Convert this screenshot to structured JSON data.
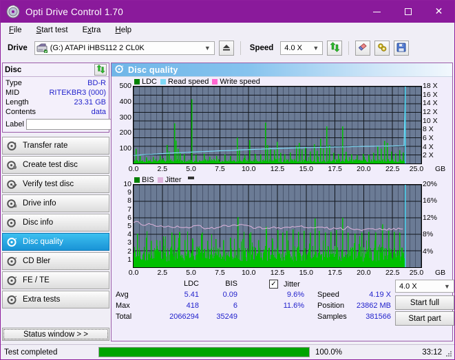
{
  "window": {
    "title": "Opti Drive Control 1.70",
    "icon": "disc-icon",
    "minimize": "minimize-icon",
    "maximize": "maximize-icon",
    "close": "close-icon"
  },
  "menu": [
    {
      "label": "File",
      "accel": "F"
    },
    {
      "label": "Start test",
      "accel": "S"
    },
    {
      "label": "Extra",
      "accel": "x"
    },
    {
      "label": "Help",
      "accel": "H"
    }
  ],
  "toolbar": {
    "drive_label": "Drive",
    "drive_value": "(G:)  ATAPI iHBS112  2 CL0K",
    "eject_icon": "eject-icon",
    "speed_label": "Speed",
    "speed_value": "4.0 X",
    "refresh_icon": "refresh-icon",
    "eraser_icon": "eraser-icon",
    "tools_icon": "tools-icon",
    "save_icon": "save-icon"
  },
  "disc": {
    "title": "Disc",
    "refresh_icon": "refresh-icon",
    "rows": [
      {
        "key": "Type",
        "value": "BD-R"
      },
      {
        "key": "MID",
        "value": "RITEKBR3 (000)"
      },
      {
        "key": "Length",
        "value": "23.31 GB"
      },
      {
        "key": "Contents",
        "value": "data"
      }
    ],
    "label_key": "Label",
    "label_value": "",
    "label_placeholder": "",
    "label_button_icon": "disc-icon"
  },
  "nav": {
    "items": [
      {
        "label": "Transfer rate",
        "icon": "disc-speed-icon",
        "active": false
      },
      {
        "label": "Create test disc",
        "icon": "disc-write-icon",
        "active": false
      },
      {
        "label": "Verify test disc",
        "icon": "disc-check-icon",
        "active": false
      },
      {
        "label": "Drive info",
        "icon": "drive-info-icon",
        "active": false
      },
      {
        "label": "Disc info",
        "icon": "disc-info-icon",
        "active": false
      },
      {
        "label": "Disc quality",
        "icon": "disc-quality-icon",
        "active": true
      },
      {
        "label": "CD Bler",
        "icon": "cd-bler-icon",
        "active": false
      },
      {
        "label": "FE / TE",
        "icon": "fe-te-icon",
        "active": false
      },
      {
        "label": "Extra tests",
        "icon": "extra-tests-icon",
        "active": false
      }
    ],
    "status_window": "Status window > >"
  },
  "main": {
    "title": "Disc quality",
    "icon": "disc-quality-icon"
  },
  "stats": {
    "col_ldc": "LDC",
    "col_bis": "BIS",
    "jitter_label": "Jitter",
    "jitter_checked": true,
    "row_avg": "Avg",
    "row_max": "Max",
    "row_total": "Total",
    "ldc_avg": "5.41",
    "ldc_max": "418",
    "ldc_total": "2066294",
    "bis_avg": "0.09",
    "bis_max": "6",
    "bis_total": "35249",
    "jitter_avg": "9.6%",
    "jitter_max": "11.6%",
    "speed_label": "Speed",
    "speed_value": "4.19 X",
    "position_label": "Position",
    "position_value": "23862 MB",
    "samples_label": "Samples",
    "samples_value": "381566",
    "speed_select": "4.0 X",
    "start_full": "Start full",
    "start_part": "Start part"
  },
  "statusbar": {
    "text": "Test completed",
    "percent_label": "100.0%",
    "percent_value": 100,
    "time": "33:12"
  },
  "colors": {
    "title_bar": "#8a1a9b",
    "plot_bg": "#6b7b95",
    "ldc_green": "#00c000",
    "read_speed": "#7fd8f5",
    "write_speed": "#ff66d0",
    "jitter_pink": "#e0b4dd",
    "accent_blue": "#2222cc",
    "progress_green": "#00a400"
  },
  "chart_data": [
    {
      "type": "area",
      "id": "ldc-chart",
      "title": "",
      "xlabel": "GB",
      "ylabel": "",
      "xlim": [
        0,
        25
      ],
      "ylim": [
        0,
        500
      ],
      "y2lim": [
        0,
        18
      ],
      "grid": true,
      "legend_position": "top-left",
      "legend": [
        "LDC",
        "Read speed",
        "Write speed"
      ],
      "xticks": [
        "0.0",
        "2.5",
        "5.0",
        "7.5",
        "10.0",
        "12.5",
        "15.0",
        "17.5",
        "20.0",
        "22.5",
        "25.0"
      ],
      "yticks": [
        100,
        200,
        300,
        400,
        500
      ],
      "y2ticks": [
        "2 X",
        "4 X",
        "6 X",
        "8 X",
        "10 X",
        "12 X",
        "14 X",
        "16 X",
        "18 X"
      ],
      "x_unit": "GB",
      "series": [
        {
          "name": "LDC",
          "color": "#00c000",
          "kind": "bars",
          "note": "dense noisy baseline ~15-40 with sparse tall spikes",
          "baseline": 22,
          "x_end": 23.6,
          "spikes": [
            {
              "x": 0.15,
              "y": 95
            },
            {
              "x": 0.55,
              "y": 48
            },
            {
              "x": 1.1,
              "y": 40
            },
            {
              "x": 1.7,
              "y": 42
            },
            {
              "x": 2.25,
              "y": 52
            },
            {
              "x": 2.9,
              "y": 120
            },
            {
              "x": 3.05,
              "y": 78
            },
            {
              "x": 3.5,
              "y": 262
            },
            {
              "x": 3.62,
              "y": 150
            },
            {
              "x": 3.8,
              "y": 95
            },
            {
              "x": 4.0,
              "y": 70
            },
            {
              "x": 4.35,
              "y": 60
            },
            {
              "x": 5.05,
              "y": 418
            },
            {
              "x": 5.4,
              "y": 55
            },
            {
              "x": 6.1,
              "y": 62
            },
            {
              "x": 6.6,
              "y": 45
            },
            {
              "x": 7.2,
              "y": 50
            },
            {
              "x": 7.9,
              "y": 58
            },
            {
              "x": 8.4,
              "y": 48
            },
            {
              "x": 8.95,
              "y": 168
            },
            {
              "x": 9.15,
              "y": 88
            },
            {
              "x": 9.6,
              "y": 55
            },
            {
              "x": 10.05,
              "y": 152
            },
            {
              "x": 10.5,
              "y": 62
            },
            {
              "x": 11.0,
              "y": 60
            },
            {
              "x": 11.45,
              "y": 265
            },
            {
              "x": 11.6,
              "y": 120
            },
            {
              "x": 11.85,
              "y": 95
            },
            {
              "x": 12.2,
              "y": 88
            },
            {
              "x": 12.45,
              "y": 140
            },
            {
              "x": 12.75,
              "y": 70
            },
            {
              "x": 13.1,
              "y": 60
            },
            {
              "x": 13.6,
              "y": 72
            },
            {
              "x": 14.1,
              "y": 115
            },
            {
              "x": 14.35,
              "y": 135
            },
            {
              "x": 14.6,
              "y": 92
            },
            {
              "x": 14.9,
              "y": 108
            },
            {
              "x": 15.3,
              "y": 78
            },
            {
              "x": 15.65,
              "y": 125
            },
            {
              "x": 15.9,
              "y": 82
            },
            {
              "x": 16.2,
              "y": 160
            },
            {
              "x": 16.45,
              "y": 95
            },
            {
              "x": 16.75,
              "y": 240
            },
            {
              "x": 17.0,
              "y": 120
            },
            {
              "x": 17.35,
              "y": 70
            },
            {
              "x": 17.75,
              "y": 62
            },
            {
              "x": 18.15,
              "y": 240
            },
            {
              "x": 18.45,
              "y": 75
            },
            {
              "x": 18.9,
              "y": 60
            },
            {
              "x": 19.4,
              "y": 55
            },
            {
              "x": 19.9,
              "y": 62
            },
            {
              "x": 20.4,
              "y": 58
            },
            {
              "x": 20.8,
              "y": 70
            },
            {
              "x": 21.2,
              "y": 112
            },
            {
              "x": 21.5,
              "y": 95
            },
            {
              "x": 21.8,
              "y": 148
            },
            {
              "x": 22.0,
              "y": 135
            },
            {
              "x": 22.35,
              "y": 78
            },
            {
              "x": 22.7,
              "y": 65
            },
            {
              "x": 23.1,
              "y": 88
            },
            {
              "x": 23.4,
              "y": 72
            }
          ]
        },
        {
          "name": "Read speed",
          "color": "#7fd8f5",
          "kind": "line",
          "axis": "right",
          "points": [
            {
              "x": 0.0,
              "y": 1.9
            },
            {
              "x": 0.5,
              "y": 2.0
            },
            {
              "x": 1.0,
              "y": 2.1
            },
            {
              "x": 1.6,
              "y": 2.15
            },
            {
              "x": 2.4,
              "y": 2.3
            },
            {
              "x": 3.2,
              "y": 2.45
            },
            {
              "x": 4.2,
              "y": 2.55
            },
            {
              "x": 5.2,
              "y": 2.7
            },
            {
              "x": 6.2,
              "y": 2.8
            },
            {
              "x": 7.3,
              "y": 2.95
            },
            {
              "x": 8.4,
              "y": 3.05
            },
            {
              "x": 9.4,
              "y": 3.2
            },
            {
              "x": 10.4,
              "y": 3.3
            },
            {
              "x": 11.4,
              "y": 3.4
            },
            {
              "x": 12.4,
              "y": 3.5
            },
            {
              "x": 13.4,
              "y": 3.6
            },
            {
              "x": 14.6,
              "y": 3.7
            },
            {
              "x": 15.8,
              "y": 3.75
            },
            {
              "x": 17.0,
              "y": 3.85
            },
            {
              "x": 18.4,
              "y": 3.9
            },
            {
              "x": 19.8,
              "y": 4.0
            },
            {
              "x": 21.2,
              "y": 4.05
            },
            {
              "x": 22.6,
              "y": 4.1
            },
            {
              "x": 23.5,
              "y": 4.15
            },
            {
              "x": 23.62,
              "y": 18.0
            }
          ]
        },
        {
          "name": "Write speed",
          "color": "#ff66d0",
          "kind": "line",
          "points": []
        }
      ]
    },
    {
      "type": "area",
      "id": "bis-jitter-chart",
      "title": "",
      "xlabel": "GB",
      "ylabel": "",
      "xlim": [
        0,
        25
      ],
      "ylim": [
        0,
        10
      ],
      "y2lim": [
        0,
        20
      ],
      "grid": true,
      "legend_position": "top-left",
      "legend": [
        "BIS",
        "Jitter"
      ],
      "xticks": [
        "0.0",
        "2.5",
        "5.0",
        "7.5",
        "10.0",
        "12.5",
        "15.0",
        "17.5",
        "20.0",
        "22.5",
        "25.0"
      ],
      "yticks": [
        1,
        2,
        3,
        4,
        5,
        6,
        7,
        8,
        9,
        10
      ],
      "y2ticks": [
        "4%",
        "8%",
        "12%",
        "16%",
        "20%"
      ],
      "x_unit": "GB",
      "series": [
        {
          "name": "BIS",
          "color": "#00c000",
          "kind": "bars",
          "baseline": 2.0,
          "x_end": 23.6,
          "note": "dense bars ~1-3 with scattered spikes to 4-6",
          "spikes": [
            {
              "x": 0.3,
              "y": 4.1
            },
            {
              "x": 1.05,
              "y": 3.6
            },
            {
              "x": 1.5,
              "y": 3.2
            },
            {
              "x": 2.0,
              "y": 3.3
            },
            {
              "x": 2.6,
              "y": 3.4
            },
            {
              "x": 3.3,
              "y": 4.2
            },
            {
              "x": 3.5,
              "y": 3.9
            },
            {
              "x": 3.95,
              "y": 4.3
            },
            {
              "x": 4.4,
              "y": 3.3
            },
            {
              "x": 5.1,
              "y": 3.5
            },
            {
              "x": 5.9,
              "y": 4.2
            },
            {
              "x": 6.4,
              "y": 3.2
            },
            {
              "x": 7.1,
              "y": 3.4
            },
            {
              "x": 7.8,
              "y": 3.3
            },
            {
              "x": 8.4,
              "y": 3.6
            },
            {
              "x": 9.05,
              "y": 6.1
            },
            {
              "x": 9.45,
              "y": 3.4
            },
            {
              "x": 10.05,
              "y": 4.1
            },
            {
              "x": 10.8,
              "y": 3.3
            },
            {
              "x": 11.5,
              "y": 4.9
            },
            {
              "x": 12.0,
              "y": 3.5
            },
            {
              "x": 12.5,
              "y": 4.5
            },
            {
              "x": 12.9,
              "y": 4.2
            },
            {
              "x": 13.3,
              "y": 4.4
            },
            {
              "x": 13.8,
              "y": 4.6
            },
            {
              "x": 14.3,
              "y": 4.3
            },
            {
              "x": 14.8,
              "y": 4.4
            },
            {
              "x": 15.3,
              "y": 4.2
            },
            {
              "x": 15.7,
              "y": 5.9
            },
            {
              "x": 16.1,
              "y": 4.4
            },
            {
              "x": 16.6,
              "y": 4.2
            },
            {
              "x": 17.1,
              "y": 4.3
            },
            {
              "x": 17.6,
              "y": 4.5
            },
            {
              "x": 18.1,
              "y": 6.0
            },
            {
              "x": 18.6,
              "y": 4.2
            },
            {
              "x": 19.2,
              "y": 4.1
            },
            {
              "x": 19.8,
              "y": 4.2
            },
            {
              "x": 20.4,
              "y": 4.3
            },
            {
              "x": 21.0,
              "y": 4.2
            },
            {
              "x": 21.6,
              "y": 5.2
            },
            {
              "x": 22.1,
              "y": 4.4
            },
            {
              "x": 22.6,
              "y": 4.3
            },
            {
              "x": 23.1,
              "y": 4.2
            }
          ]
        },
        {
          "name": "Jitter",
          "color": "#e0b4dd",
          "kind": "line",
          "axis": "right",
          "unit": "%",
          "points": [
            {
              "x": 0.0,
              "y": 10.6
            },
            {
              "x": 0.25,
              "y": 11.4
            },
            {
              "x": 0.6,
              "y": 10.4
            },
            {
              "x": 1.0,
              "y": 10.3
            },
            {
              "x": 1.5,
              "y": 10.5
            },
            {
              "x": 2.0,
              "y": 10.2
            },
            {
              "x": 2.6,
              "y": 10.0
            },
            {
              "x": 3.2,
              "y": 9.9
            },
            {
              "x": 3.8,
              "y": 9.8
            },
            {
              "x": 4.4,
              "y": 9.6
            },
            {
              "x": 5.0,
              "y": 9.7
            },
            {
              "x": 5.6,
              "y": 10.1
            },
            {
              "x": 6.2,
              "y": 9.4
            },
            {
              "x": 6.8,
              "y": 9.5
            },
            {
              "x": 7.4,
              "y": 9.6
            },
            {
              "x": 8.0,
              "y": 10.1
            },
            {
              "x": 8.6,
              "y": 10.0
            },
            {
              "x": 9.2,
              "y": 10.3
            },
            {
              "x": 9.8,
              "y": 10.1
            },
            {
              "x": 10.4,
              "y": 9.6
            },
            {
              "x": 11.0,
              "y": 9.5
            },
            {
              "x": 11.6,
              "y": 9.6
            },
            {
              "x": 12.2,
              "y": 9.7
            },
            {
              "x": 12.8,
              "y": 9.6
            },
            {
              "x": 13.4,
              "y": 9.7
            },
            {
              "x": 14.0,
              "y": 9.6
            },
            {
              "x": 14.6,
              "y": 9.8
            },
            {
              "x": 15.2,
              "y": 9.6
            },
            {
              "x": 15.8,
              "y": 9.5
            },
            {
              "x": 16.4,
              "y": 9.6
            },
            {
              "x": 17.0,
              "y": 9.4
            },
            {
              "x": 17.6,
              "y": 9.5
            },
            {
              "x": 18.2,
              "y": 9.3
            },
            {
              "x": 18.6,
              "y": 9.7
            },
            {
              "x": 19.2,
              "y": 9.2
            },
            {
              "x": 19.8,
              "y": 9.1
            },
            {
              "x": 20.4,
              "y": 9.2
            },
            {
              "x": 21.0,
              "y": 9.1
            },
            {
              "x": 21.6,
              "y": 9.3
            },
            {
              "x": 22.2,
              "y": 9.2
            },
            {
              "x": 22.8,
              "y": 9.3
            },
            {
              "x": 23.4,
              "y": 9.3
            }
          ]
        }
      ]
    }
  ]
}
